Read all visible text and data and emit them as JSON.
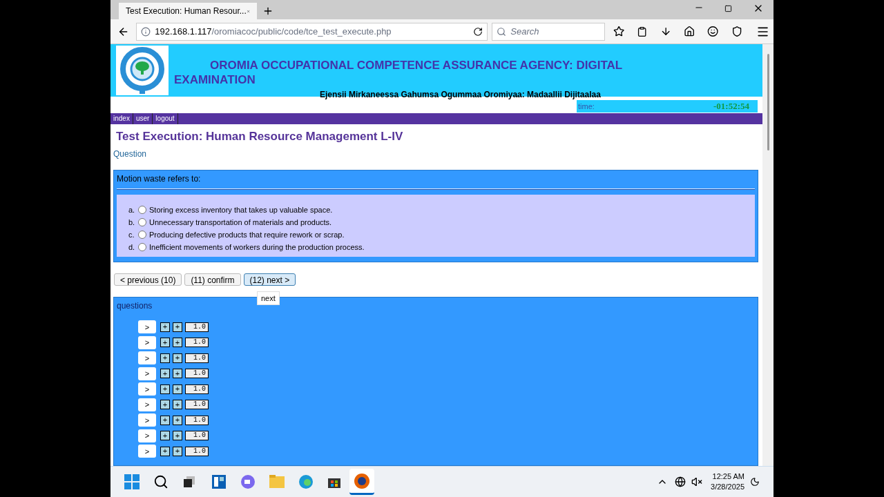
{
  "browser": {
    "tab_title": "Test Execution: Human Resour...",
    "url_host": "192.168.1.117",
    "url_path": "/oromiacoc/public/code/tce_test_execute.php",
    "search_placeholder": "Search"
  },
  "header": {
    "title": "OROMIA OCCUPATIONAL COMPETENCE ASSURANCE AGENCY: DIGITAL EXAMINATION",
    "subtitle": "Ejensii Mirkaneessa Gahumsa Ogummaa Oromiyaa: Madaallii Dijitaalaa",
    "timer_label": "time:",
    "timer_value": "-01:52:54"
  },
  "nav": [
    "index",
    "user",
    "logout"
  ],
  "heading": "Test Execution: Human Resource Management L-IV",
  "section_label": "Question",
  "question": {
    "text": "Motion waste refers to:",
    "options": [
      {
        "letter": "a.",
        "text": "Storing excess inventory that takes up valuable space.",
        "selected": false
      },
      {
        "letter": "b.",
        "text": "Unnecessary transportation of materials and products.",
        "selected": false
      },
      {
        "letter": "c.",
        "text": "Producing defective products that require rework or scrap.",
        "selected": false
      },
      {
        "letter": "d.",
        "text": "Inefficient movements of workers during the production process.",
        "selected": false
      }
    ]
  },
  "buttons": [
    {
      "label": "< previous (10)",
      "hover": false
    },
    {
      "label": "(11) confirm",
      "hover": false
    },
    {
      "label": "(12) next >",
      "hover": true
    }
  ],
  "tooltip": "next",
  "questions": {
    "title": "questions",
    "rows": [
      {
        "go": ">",
        "add_1": "+",
        "add_2": "+",
        "score": "1.0"
      },
      {
        "go": ">",
        "add_1": "+",
        "add_2": "+",
        "score": "1.0"
      },
      {
        "go": ">",
        "add_1": "+",
        "add_2": "+",
        "score": "1.0"
      },
      {
        "go": ">",
        "add_1": "+",
        "add_2": "+",
        "score": "1.0"
      },
      {
        "go": ">",
        "add_1": "+",
        "add_2": "+",
        "score": "1.0"
      },
      {
        "go": ">",
        "add_1": "+",
        "add_2": "+",
        "score": "1.0"
      },
      {
        "go": ">",
        "add_1": "+",
        "add_2": "+",
        "score": "1.0"
      },
      {
        "go": ">",
        "add_1": "+",
        "add_2": "+",
        "score": "1.0"
      },
      {
        "go": ">",
        "add_1": "+",
        "add_2": "+",
        "score": "1.0"
      }
    ]
  },
  "taskbar": {
    "time": "12:25 AM",
    "date": "3/28/2025"
  }
}
